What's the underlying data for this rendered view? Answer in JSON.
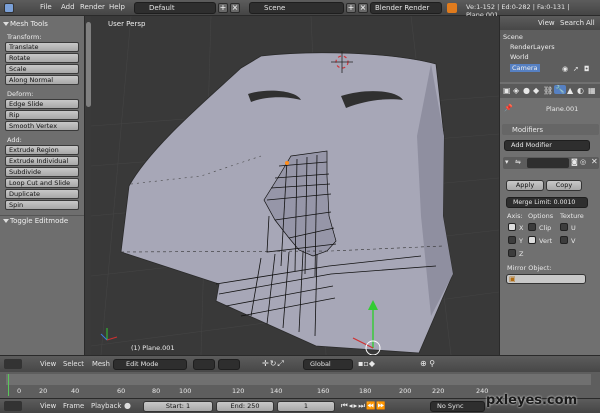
{
  "topbar": {
    "menu": [
      "File",
      "Add",
      "Render",
      "Help"
    ],
    "layout": "Default",
    "scene": "Scene",
    "engine": "Blender Render",
    "stats": "Ve:1-152 | Ed:0-282 | Fa:0-131 | Plane.001"
  },
  "toolshelf": {
    "title": "Mesh Tools",
    "transform_label": "Transform:",
    "transform": [
      "Translate",
      "Rotate",
      "Scale",
      "Along Normal"
    ],
    "deform_label": "Deform:",
    "deform": [
      "Edge Slide",
      "Rip",
      "Smooth Vertex"
    ],
    "add_label": "Add:",
    "add": [
      "Extrude Region",
      "Extrude Individual",
      "Subdivide",
      "Loop Cut and Slide",
      "Duplicate",
      "Spin"
    ],
    "toggle": "Toggle Editmode"
  },
  "viewport": {
    "view_name": "User Persp",
    "object_name": "(1) Plane.001"
  },
  "outliner": {
    "menu": [
      "View",
      "Search",
      "All"
    ],
    "items": [
      "Scene",
      "RenderLayers",
      "World",
      "Camera"
    ]
  },
  "properties": {
    "object": "Plane.001",
    "panel": "Modifiers",
    "add_modifier": "Add Modifier",
    "apply": "Apply",
    "copy": "Copy",
    "merge_limit": "Merge Limit: 0.0010",
    "axis_label": "Axis:",
    "options_label": "Options",
    "texture_label": "Texture",
    "axes": [
      "X",
      "Y",
      "Z"
    ],
    "clip": "Clip",
    "vert": "Vert",
    "u": "U",
    "v": "V",
    "mirror_object": "Mirror Object:"
  },
  "viewheader": {
    "menu": [
      "View",
      "Select",
      "Mesh"
    ],
    "mode": "Edit Mode",
    "orientation": "Global"
  },
  "timeline": {
    "ticks": [
      "20",
      "40",
      "60",
      "80",
      "100",
      "120",
      "140",
      "160",
      "180",
      "200",
      "220",
      "240"
    ],
    "zero": "0"
  },
  "bottombar": {
    "menu": [
      "View",
      "Frame",
      "Playback"
    ],
    "start": "Start: 1",
    "end": "End: 250",
    "current": "1",
    "sync": "No Sync"
  },
  "watermark": "pxleyes.com",
  "colors": {
    "mesh_face": "#a7a7b7",
    "selected": "#ff8c1a",
    "accent_blue": "#5680c2"
  }
}
